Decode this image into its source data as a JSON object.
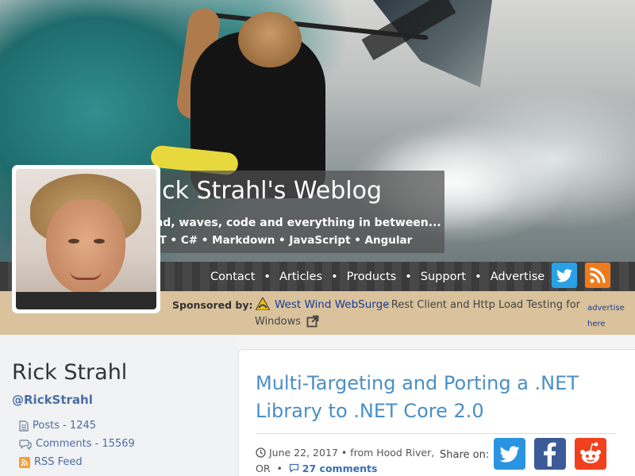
{
  "blog": {
    "title": "Rick Strahl's Weblog",
    "tagline": "Wind, waves, code and everything in between...",
    "topics": ".NET • C# • Markdown • JavaScript • Angular"
  },
  "nav": {
    "items": [
      {
        "label": "Contact"
      },
      {
        "label": "Articles"
      },
      {
        "label": "Products"
      },
      {
        "label": "Support"
      },
      {
        "label": "Advertise"
      }
    ],
    "separator": "•",
    "social": [
      {
        "icon": "twitter-icon",
        "color": "#2aa0e6"
      },
      {
        "icon": "rss-icon",
        "color": "#f07b1c"
      }
    ]
  },
  "sponsor": {
    "label": "Sponsored by:",
    "link_text": "West Wind WebSurge",
    "description_line1": "- Rest Client and Http Load Testing for",
    "description_line2": "Windows",
    "advertise_label": "advertise here"
  },
  "sidebar": {
    "author_name": "Rick Strahl",
    "handle": "@RickStrahl",
    "stats": [
      {
        "icon": "document-icon",
        "label": "Posts - 1245"
      },
      {
        "icon": "comments-icon",
        "label": "Comments - 15569"
      },
      {
        "icon": "rss-icon",
        "label": "RSS Feed"
      }
    ]
  },
  "article": {
    "title": "Multi-Targeting and Porting a .NET Library to .NET Core 2.0",
    "date": "June 22, 2017",
    "location": "• from Hood River, OR",
    "bullet": "•",
    "comments": "27 comments",
    "share_label": "Share on:",
    "share": [
      {
        "icon": "twitter-icon",
        "color": "#2b94e0"
      },
      {
        "icon": "facebook-icon",
        "color": "#3b5b98"
      },
      {
        "icon": "reddit-icon",
        "color": "#f0401d"
      }
    ]
  },
  "colors": {
    "link": "#4a8fc7",
    "sponsor_bar": "#d9c29c",
    "nav_bar": "#3b3b3b"
  }
}
